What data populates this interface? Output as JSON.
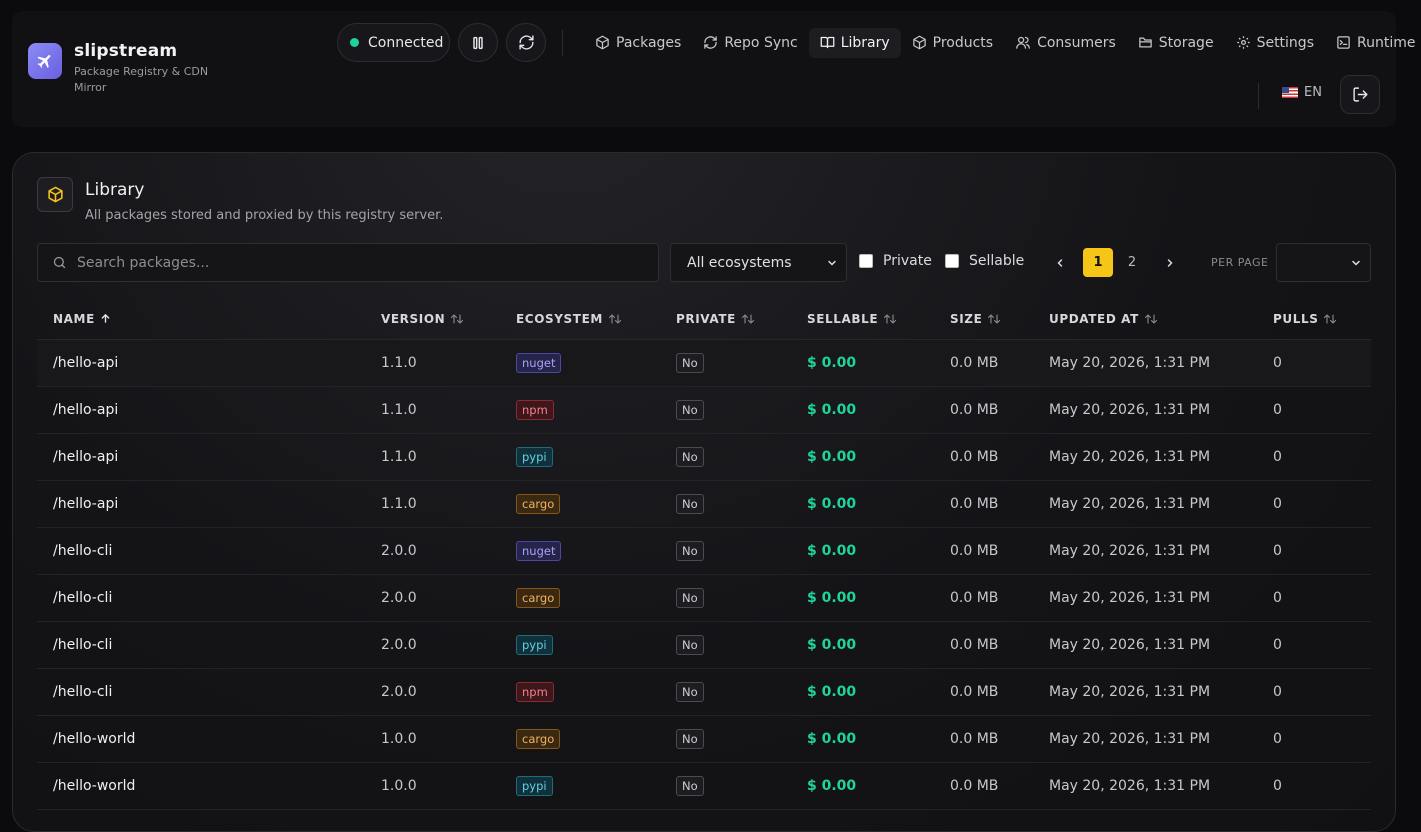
{
  "app": {
    "name": "slipstream",
    "subtitle": "Package Registry & CDN Mirror"
  },
  "header": {
    "status": "Connected",
    "nav": [
      {
        "label": "Packages",
        "icon": "box-icon",
        "active": false
      },
      {
        "label": "Repo Sync",
        "icon": "refresh-icon",
        "active": false
      },
      {
        "label": "Library",
        "icon": "book-icon",
        "active": true
      },
      {
        "label": "Products",
        "icon": "box-icon",
        "active": false
      },
      {
        "label": "Consumers",
        "icon": "users-icon",
        "active": false
      },
      {
        "label": "Storage",
        "icon": "folder-icon",
        "active": false
      },
      {
        "label": "Settings",
        "icon": "gear-icon",
        "active": false
      },
      {
        "label": "Runtime",
        "icon": "terminal-icon",
        "active": false
      }
    ],
    "language": "EN"
  },
  "library": {
    "title": "Library",
    "description": "All packages stored and proxied by this registry server.",
    "search_placeholder": "Search packages...",
    "ecosystem_filter": "All ecosystems",
    "private_label": "Private",
    "sellable_label": "Sellable",
    "pages": [
      "1",
      "2"
    ],
    "current_page": "1",
    "per_page_label": "PER PAGE",
    "per_page_value": ""
  },
  "table": {
    "columns": [
      "NAME",
      "VERSION",
      "ECOSYSTEM",
      "PRIVATE",
      "SELLABLE",
      "SIZE",
      "UPDATED AT",
      "PULLS"
    ],
    "rows": [
      {
        "name": "/hello-api",
        "version": "1.1.0",
        "ecosystem": "nuget",
        "private": "No",
        "sellable": "$ 0.00",
        "size": "0.0 MB",
        "updated": "May 20, 2026, 1:31 PM",
        "pulls": "0"
      },
      {
        "name": "/hello-api",
        "version": "1.1.0",
        "ecosystem": "npm",
        "private": "No",
        "sellable": "$ 0.00",
        "size": "0.0 MB",
        "updated": "May 20, 2026, 1:31 PM",
        "pulls": "0"
      },
      {
        "name": "/hello-api",
        "version": "1.1.0",
        "ecosystem": "pypi",
        "private": "No",
        "sellable": "$ 0.00",
        "size": "0.0 MB",
        "updated": "May 20, 2026, 1:31 PM",
        "pulls": "0"
      },
      {
        "name": "/hello-api",
        "version": "1.1.0",
        "ecosystem": "cargo",
        "private": "No",
        "sellable": "$ 0.00",
        "size": "0.0 MB",
        "updated": "May 20, 2026, 1:31 PM",
        "pulls": "0"
      },
      {
        "name": "/hello-cli",
        "version": "2.0.0",
        "ecosystem": "nuget",
        "private": "No",
        "sellable": "$ 0.00",
        "size": "0.0 MB",
        "updated": "May 20, 2026, 1:31 PM",
        "pulls": "0"
      },
      {
        "name": "/hello-cli",
        "version": "2.0.0",
        "ecosystem": "cargo",
        "private": "No",
        "sellable": "$ 0.00",
        "size": "0.0 MB",
        "updated": "May 20, 2026, 1:31 PM",
        "pulls": "0"
      },
      {
        "name": "/hello-cli",
        "version": "2.0.0",
        "ecosystem": "pypi",
        "private": "No",
        "sellable": "$ 0.00",
        "size": "0.0 MB",
        "updated": "May 20, 2026, 1:31 PM",
        "pulls": "0"
      },
      {
        "name": "/hello-cli",
        "version": "2.0.0",
        "ecosystem": "npm",
        "private": "No",
        "sellable": "$ 0.00",
        "size": "0.0 MB",
        "updated": "May 20, 2026, 1:31 PM",
        "pulls": "0"
      },
      {
        "name": "/hello-world",
        "version": "1.0.0",
        "ecosystem": "cargo",
        "private": "No",
        "sellable": "$ 0.00",
        "size": "0.0 MB",
        "updated": "May 20, 2026, 1:31 PM",
        "pulls": "0"
      },
      {
        "name": "/hello-world",
        "version": "1.0.0",
        "ecosystem": "pypi",
        "private": "No",
        "sellable": "$ 0.00",
        "size": "0.0 MB",
        "updated": "May 20, 2026, 1:31 PM",
        "pulls": "0"
      }
    ]
  },
  "colors": {
    "accent": "#f5c518",
    "success": "#1fd49a",
    "brand": "#7b78f0"
  }
}
